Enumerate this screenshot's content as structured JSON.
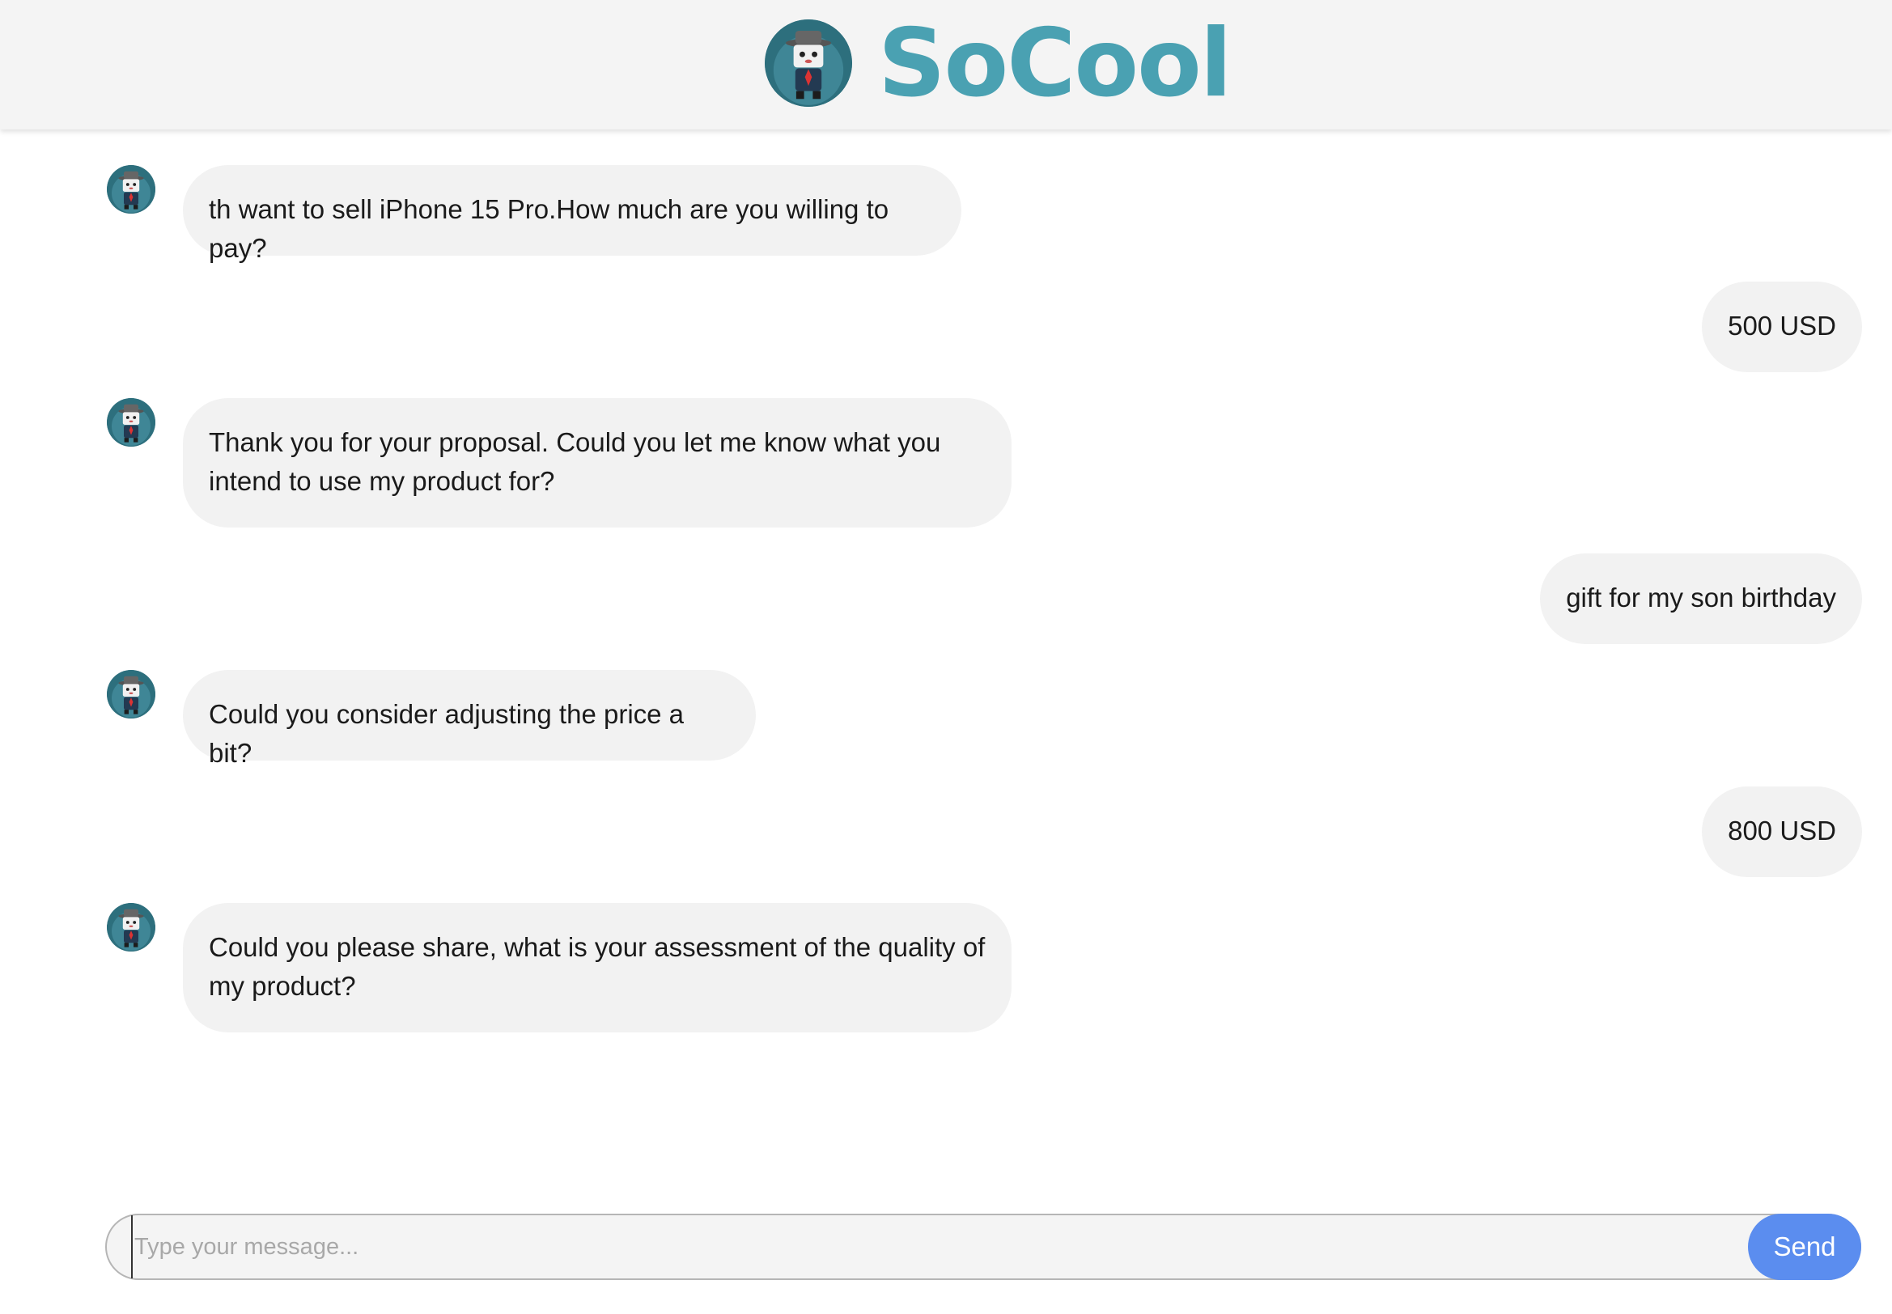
{
  "header": {
    "brand": "SoCool",
    "logo_icon": "robot-detective-avatar-icon",
    "brand_color": "#4aa1b2"
  },
  "messages": [
    {
      "sender": "bot",
      "text": "th want to sell iPhone 15 Pro.How much are you willing to pay?"
    },
    {
      "sender": "user",
      "text": "500 USD"
    },
    {
      "sender": "bot",
      "text": "Thank you for your proposal. Could you let me know what you intend to use my product for?"
    },
    {
      "sender": "user",
      "text": "gift for my son birthday"
    },
    {
      "sender": "bot",
      "text": "Could you consider adjusting the price a bit?"
    },
    {
      "sender": "user",
      "text": "800 USD"
    },
    {
      "sender": "bot",
      "text": "Could you please share, what is your assessment of the quality of my product?"
    }
  ],
  "composer": {
    "value": "",
    "placeholder": "Type your message...",
    "send_label": "Send",
    "send_color": "#5b8def"
  }
}
